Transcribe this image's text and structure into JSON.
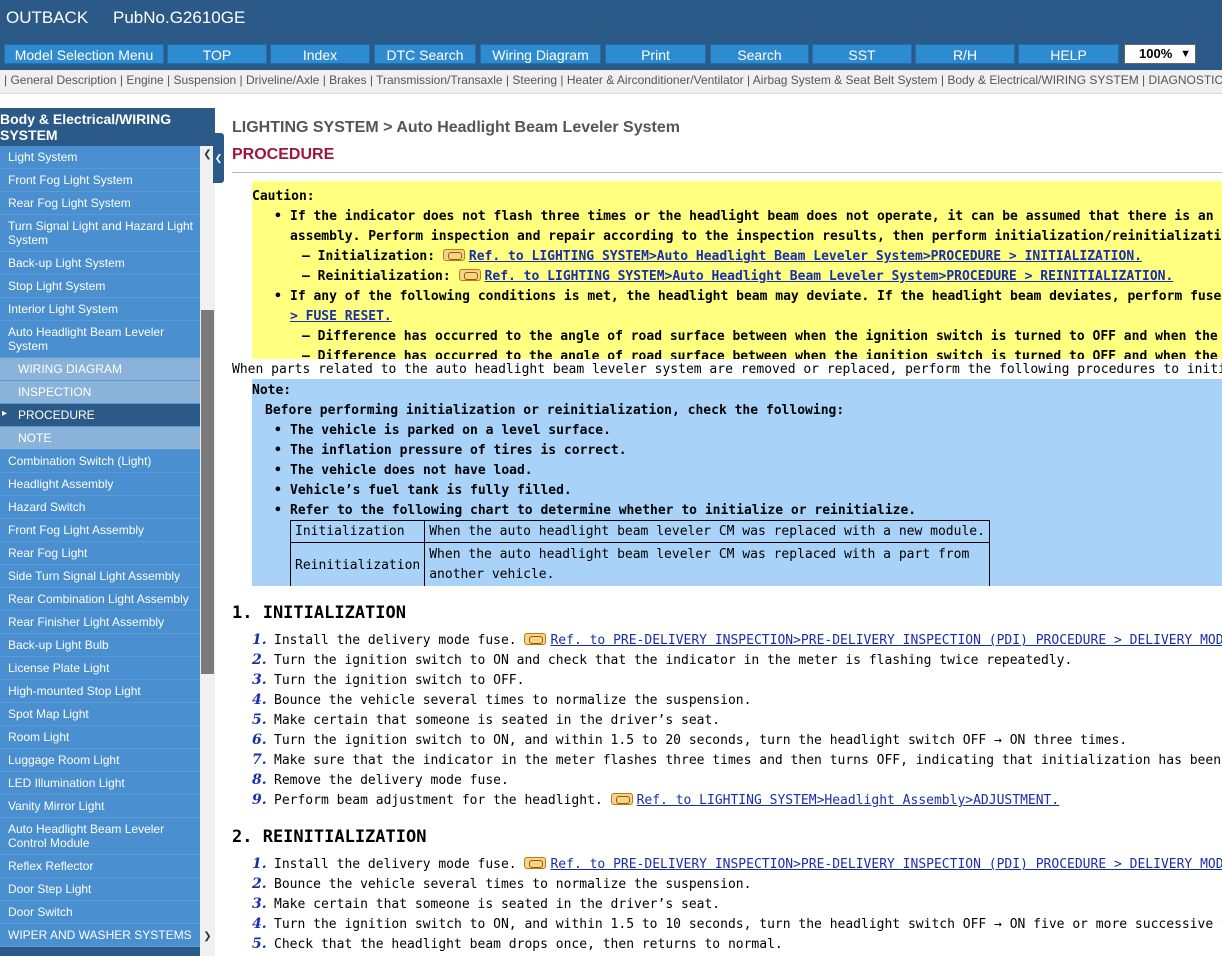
{
  "titlebar": {
    "model": "OUTBACK",
    "pub": "PubNo.G2610GE"
  },
  "nav": {
    "buttons": [
      "Model Selection Menu",
      "TOP",
      "Index",
      "DTC Search",
      "Wiring Diagram",
      "Print",
      "Search",
      "SST",
      "R/H",
      "HELP"
    ],
    "zoom": "100%"
  },
  "categories": [
    "General Description",
    "Engine",
    "Suspension",
    "Driveline/Axle",
    "Brakes",
    "Transmission/Transaxle",
    "Steering",
    "Heater & Airconditioner/Ventilator",
    "Airbag System & Seat Belt System",
    "Body & Electrical/WIRING SYSTEM",
    "DIAGNOSTIC"
  ],
  "sidebar": {
    "header_line1": "Body & Electrical/WIRING",
    "header_line2": "SYSTEM",
    "items": [
      {
        "label": "Light System",
        "kind": "item"
      },
      {
        "label": "Front Fog Light System",
        "kind": "item"
      },
      {
        "label": "Rear Fog Light System",
        "kind": "item"
      },
      {
        "label": "Turn Signal Light and Hazard Light System",
        "kind": "item"
      },
      {
        "label": "Back-up Light System",
        "kind": "item"
      },
      {
        "label": "Stop Light System",
        "kind": "item"
      },
      {
        "label": "Interior Light System",
        "kind": "item"
      },
      {
        "label": "Auto Headlight Beam Leveler System",
        "kind": "item"
      },
      {
        "label": "WIRING DIAGRAM",
        "kind": "sub"
      },
      {
        "label": "INSPECTION",
        "kind": "sub"
      },
      {
        "label": "PROCEDURE",
        "kind": "active"
      },
      {
        "label": "NOTE",
        "kind": "sub"
      },
      {
        "label": "Combination Switch (Light)",
        "kind": "item"
      },
      {
        "label": "Headlight Assembly",
        "kind": "item"
      },
      {
        "label": "Hazard Switch",
        "kind": "item"
      },
      {
        "label": "Front Fog Light Assembly",
        "kind": "item"
      },
      {
        "label": "Rear Fog Light",
        "kind": "item"
      },
      {
        "label": "Side Turn Signal Light Assembly",
        "kind": "item"
      },
      {
        "label": "Rear Combination Light Assembly",
        "kind": "item"
      },
      {
        "label": "Rear Finisher Light Assembly",
        "kind": "item"
      },
      {
        "label": "Back-up Light Bulb",
        "kind": "item"
      },
      {
        "label": "License Plate Light",
        "kind": "item"
      },
      {
        "label": "High-mounted Stop Light",
        "kind": "item"
      },
      {
        "label": "Spot Map Light",
        "kind": "item"
      },
      {
        "label": "Room Light",
        "kind": "item"
      },
      {
        "label": "Luggage Room Light",
        "kind": "item"
      },
      {
        "label": "LED Illumination Light",
        "kind": "item"
      },
      {
        "label": "Vanity Mirror Light",
        "kind": "item"
      },
      {
        "label": "Auto Headlight Beam Leveler Control Module",
        "kind": "item"
      },
      {
        "label": "Reflex Reflector",
        "kind": "item"
      },
      {
        "label": "Door Step Light",
        "kind": "item"
      },
      {
        "label": "Door Switch",
        "kind": "item"
      },
      {
        "label": "WIPER AND WASHER SYSTEMS",
        "kind": "item"
      }
    ]
  },
  "main": {
    "breadcrumb": "LIGHTING SYSTEM > Auto Headlight Beam Leveler System",
    "title": "PROCEDURE",
    "caution": {
      "heading": "Caution:",
      "b1_l1": "If the indicator does not flash three times or the headlight beam does not operate, it can be assumed that there is an open c",
      "b1_l2": "assembly. Perform inspection and repair according to the inspection results, then perform initialization/reinitialization agai",
      "s1_label": "Initialization:",
      "s1_link": "Ref. to LIGHTING SYSTEM>Auto Headlight Beam Leveler System>PROCEDURE > INITIALIZATION.",
      "s2_label": "Reinitialization:",
      "s2_link": "Ref. to LIGHTING SYSTEM>Auto Headlight Beam Leveler System>PROCEDURE > REINITIALIZATION.",
      "b2_l1": "If any of the following conditions is met, the headlight beam may deviate. If the headlight beam deviates, perform fuse rese",
      "b2_link": "> FUSE RESET.",
      "s3": "Difference has occurred to the angle of road surface between when the ignition switch is turned to OFF and when the ign",
      "s4": "Difference has occurred to the angle of road surface between when the ignition switch is turned to OFF and when the veh"
    },
    "intro": "When parts related to the auto headlight beam leveler system are removed or replaced, perform the following procedures to initialize or reinitialize",
    "note": {
      "heading": "Note:",
      "lead": "Before performing initialization or reinitialization, check the following:",
      "b1": "The vehicle is parked on a level surface.",
      "b2": "The inflation pressure of tires is correct.",
      "b3": "The vehicle does not have load.",
      "b4": "Vehicle’s fuel tank is fully filled.",
      "b5": "Refer to the following chart to determine whether to initialize or reinitialize.",
      "table": [
        [
          "Initialization",
          "When the auto headlight beam leveler CM was replaced with a new module."
        ],
        [
          "Reinitialization",
          "When the auto headlight beam leveler CM was replaced with a part from another vehicle."
        ]
      ]
    },
    "init": {
      "heading": "1. INITIALIZATION",
      "steps": [
        {
          "num": "1.",
          "text": "Install the delivery mode fuse.",
          "link": "Ref. to PRE-DELIVERY INSPECTION>PRE-DELIVERY INSPECTION (PDI) PROCEDURE > DELIVERY MODE."
        },
        {
          "num": "2.",
          "text": "Turn the ignition switch to ON and check that the indicator in the meter is flashing twice repeatedly.",
          "link": ""
        },
        {
          "num": "3.",
          "text": "Turn the ignition switch to OFF.",
          "link": ""
        },
        {
          "num": "4.",
          "text": "Bounce the vehicle several times to normalize the suspension.",
          "link": ""
        },
        {
          "num": "5.",
          "text": "Make certain that someone is seated in the driver’s seat.",
          "link": ""
        },
        {
          "num": "6.",
          "text": "Turn the ignition switch to ON, and within 1.5 to 20 seconds, turn the headlight switch OFF → ON three times.",
          "link": ""
        },
        {
          "num": "7.",
          "text": "Make sure that the indicator in the meter flashes three times and then turns OFF, indicating that initialization has been successfully complete",
          "link": ""
        },
        {
          "num": "8.",
          "text": "Remove the delivery mode fuse.",
          "link": ""
        },
        {
          "num": "9.",
          "text": "Perform beam adjustment for the headlight.",
          "link": "Ref. to LIGHTING SYSTEM>Headlight Assembly>ADJUSTMENT."
        }
      ]
    },
    "reinit": {
      "heading": "2. REINITIALIZATION",
      "steps": [
        {
          "num": "1.",
          "text": "Install the delivery mode fuse.",
          "link": "Ref. to PRE-DELIVERY INSPECTION>PRE-DELIVERY INSPECTION (PDI) PROCEDURE > DELIVERY MODE."
        },
        {
          "num": "2.",
          "text": "Bounce the vehicle several times to normalize the suspension.",
          "link": ""
        },
        {
          "num": "3.",
          "text": "Make certain that someone is seated in the driver’s seat.",
          "link": ""
        },
        {
          "num": "4.",
          "text": "Turn the ignition switch to ON, and within 1.5 to 10 seconds, turn the headlight switch OFF → ON five or more successive times.",
          "link": ""
        },
        {
          "num": "5.",
          "text": "Check that the headlight beam drops once, then returns to normal.",
          "link": ""
        }
      ]
    }
  }
}
